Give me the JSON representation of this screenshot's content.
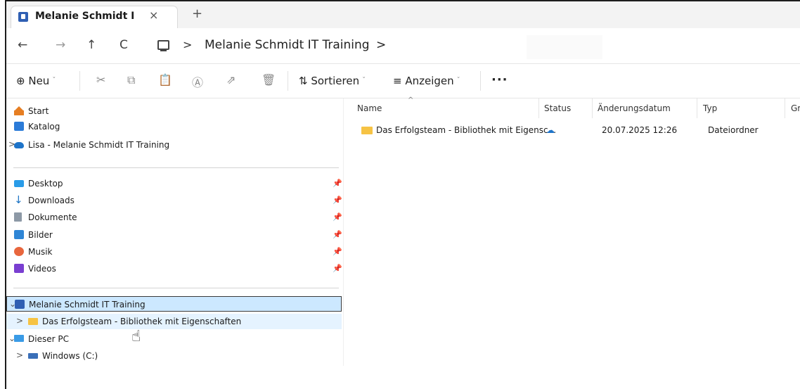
{
  "tab": {
    "title": "Melanie Schmidt IT Tra",
    "close": "×",
    "new": "+"
  },
  "nav": {
    "back": "←",
    "forward": "→",
    "up": "↑",
    "refresh": "C"
  },
  "breadcrumb": {
    "sep": ">",
    "item": "Melanie Schmidt IT Training",
    "trailing_sep": ">"
  },
  "commands": {
    "new_label": "Neu",
    "new_icon": "⊕",
    "chevron": "ˇ",
    "cut": "✂",
    "copy": "⧉",
    "paste": "📋",
    "rename": "Ⓐ",
    "share": "⇗",
    "delete": "🗑",
    "sort_label": "Sortieren",
    "sort_icon": "⇅",
    "view_label": "Anzeigen",
    "view_icon": "≡",
    "more": "···"
  },
  "sidebar": {
    "top": [
      {
        "label": "Start",
        "icon": "home-icon"
      },
      {
        "label": "Katalog",
        "icon": "gallery-icon"
      },
      {
        "label": "Lisa - Melanie Schmidt IT Training",
        "icon": "onedrive-cloud-icon",
        "expander": ">"
      }
    ],
    "quick_access": [
      {
        "label": "Desktop",
        "icon": "desktop-icon"
      },
      {
        "label": "Downloads",
        "icon": "download-icon"
      },
      {
        "label": "Dokumente",
        "icon": "document-icon"
      },
      {
        "label": "Bilder",
        "icon": "pictures-icon"
      },
      {
        "label": "Musik",
        "icon": "music-icon"
      },
      {
        "label": "Videos",
        "icon": "videos-icon"
      }
    ],
    "pin_glyph": "📌",
    "tree": [
      {
        "label": "Melanie Schmidt IT Training",
        "icon": "library-icon",
        "expander": "⌄"
      },
      {
        "label": "Das Erfolgsteam - Bibliothek mit Eigenschaften",
        "icon": "folder-icon",
        "expander": ">"
      },
      {
        "label": "Dieser PC",
        "icon": "pc-icon",
        "expander": "⌄"
      },
      {
        "label": "Windows (C:)",
        "icon": "drive-icon",
        "expander": ">"
      }
    ]
  },
  "columns": {
    "name": "Name",
    "status": "Status",
    "modified": "Änderungsdatum",
    "type": "Typ",
    "size": "Gr",
    "sort_caret": "^"
  },
  "rows": [
    {
      "name": "Das Erfolgsteam - Bibliothek mit Eigensc...",
      "status": "☁",
      "modified": "20.07.2025 12:26",
      "type": "Dateiordner"
    }
  ],
  "cursor": "☝",
  "colors": {
    "selection": "#cce8ff",
    "hover": "#e5f3ff",
    "accent": "#1e74c9",
    "folder": "#f6c344"
  }
}
